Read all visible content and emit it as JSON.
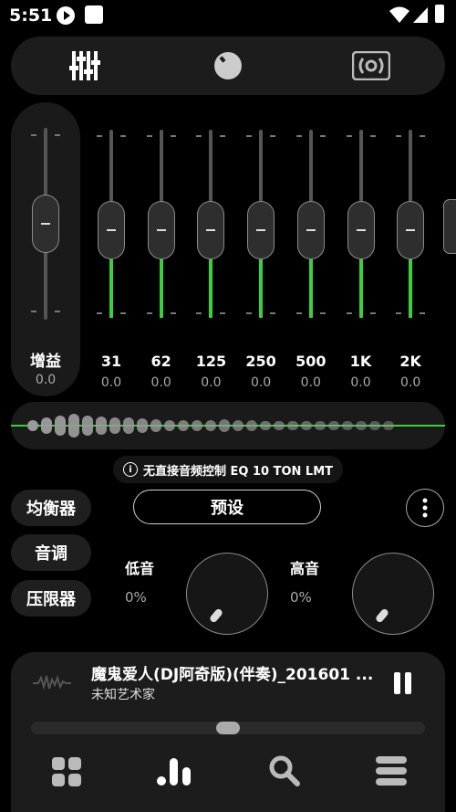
{
  "status_bar": {
    "time": "5:51"
  },
  "top_tabs": [
    {
      "icon": "equalizer-sliders-icon"
    },
    {
      "icon": "knob-icon"
    },
    {
      "icon": "virtualizer-icon"
    }
  ],
  "gain": {
    "label": "增益",
    "value": "0.0",
    "level": 0.5
  },
  "bands": [
    {
      "freq": "31",
      "value": "0.0",
      "level": 0.5
    },
    {
      "freq": "62",
      "value": "0.0",
      "level": 0.5
    },
    {
      "freq": "125",
      "value": "0.0",
      "level": 0.5
    },
    {
      "freq": "250",
      "value": "0.0",
      "level": 0.5
    },
    {
      "freq": "500",
      "value": "0.0",
      "level": 0.5
    },
    {
      "freq": "1K",
      "value": "0.0",
      "level": 0.5
    },
    {
      "freq": "2K",
      "value": "0.0",
      "level": 0.5
    }
  ],
  "info_text": "无直接音频控制 EQ 10 TON LMT",
  "side_buttons": {
    "equalizer": "均衡器",
    "tone": "音调",
    "limiter": "压限器"
  },
  "preset_label": "预设",
  "bass": {
    "label": "低音",
    "value": "0%",
    "level": 0
  },
  "treble": {
    "label": "高音",
    "value": "0%",
    "level": 0
  },
  "player": {
    "title": "魔鬼爱人(DJ阿奇版)(伴奏)_201601 ...",
    "artist": "未知艺术家",
    "progress": 0.5
  },
  "bottom_nav": [
    {
      "icon": "grid-icon"
    },
    {
      "icon": "bar-chart-icon"
    },
    {
      "icon": "search-icon"
    },
    {
      "icon": "menu-icon"
    }
  ],
  "colors": {
    "accent": "#37d13c",
    "background": "#000000",
    "panel": "#1c1c1c"
  }
}
